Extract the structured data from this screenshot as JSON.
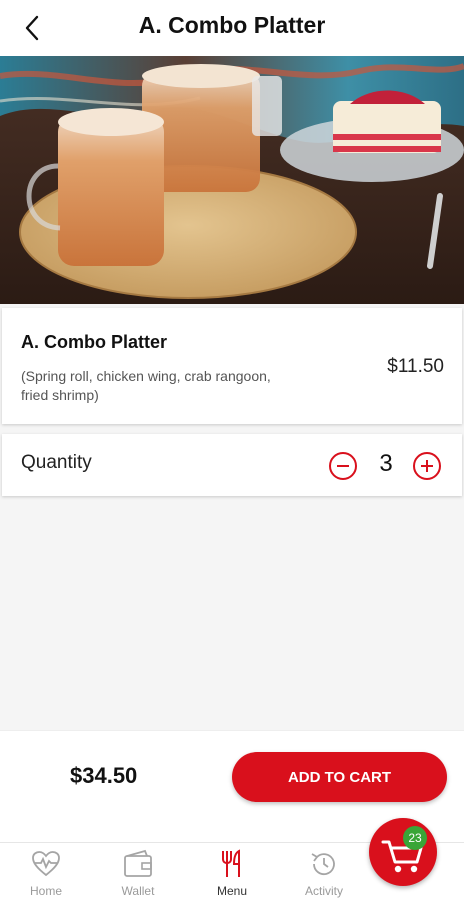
{
  "header": {
    "title": "A. Combo Platter",
    "back_icon": "chevron-left-icon"
  },
  "hero": {
    "image": "thai-iced-tea-and-cake-photo"
  },
  "item": {
    "name": "A. Combo Platter",
    "description": "(Spring roll, chicken wing, crab rangoon, fried shrimp)",
    "price": "$11.50"
  },
  "quantity": {
    "label": "Quantity",
    "value": "3"
  },
  "footer": {
    "total": "$34.50",
    "add_to_cart_label": "ADD TO CART"
  },
  "tabs": [
    {
      "label": "Home",
      "icon": "heartbeat-icon"
    },
    {
      "label": "Wallet",
      "icon": "wallet-icon"
    },
    {
      "label": "Menu",
      "icon": "fork-knife-icon"
    },
    {
      "label": "Activity",
      "icon": "history-icon"
    }
  ],
  "cart": {
    "count": "23",
    "icon": "cart-icon"
  },
  "colors": {
    "accent": "#d9101c",
    "badge": "#3aa537"
  }
}
